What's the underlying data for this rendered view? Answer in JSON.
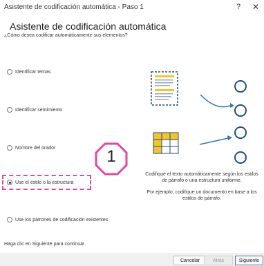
{
  "window": {
    "title": "Asistente de codificación automática - Paso 1",
    "help_label": "?",
    "close_label": "✕"
  },
  "dialog": {
    "heading": "Asistente de codificación automática",
    "question": "¿Cómo desea codificar automáticamente sus elementos?",
    "options": [
      {
        "label": "Identificar temas",
        "selected": false
      },
      {
        "label": "Identificar sentimiento",
        "selected": false
      },
      {
        "label": "Nombre del orador",
        "selected": false
      },
      {
        "label": "Use el estilo o la estructura",
        "selected": true
      },
      {
        "label": "Use los patrones de codificación existentes",
        "selected": false
      }
    ],
    "description_1": "Codifique el texto automáticamente según los estilos de párrafo o una estructura uniforme.",
    "description_2": "Por ejemplo, codifique un documento en base a los estilos de párrafo.",
    "footer_note": "Haga clic en Siguiente para continuar"
  },
  "callout": {
    "number": "1"
  },
  "buttons": {
    "cancel": "Cancelar",
    "back": "Atrás",
    "next": "Siguiente"
  },
  "colors": {
    "accent_blue": "#1f4e79",
    "arrow_blue": "#2e75b6",
    "document_yellow": "#f4c430",
    "highlight_pink": "#e6479b"
  },
  "icons": {
    "document": "document-icon",
    "table": "table-grid-icon",
    "arrow": "arrow-right-icon",
    "node": "circle-node-icon"
  }
}
